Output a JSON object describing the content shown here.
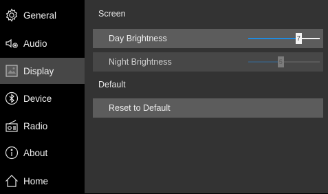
{
  "sidebar": {
    "items": [
      {
        "label": "General",
        "icon": "gear-icon",
        "active": false
      },
      {
        "label": "Audio",
        "icon": "speaker-icon",
        "active": false
      },
      {
        "label": "Display",
        "icon": "display-icon",
        "active": true
      },
      {
        "label": "Device",
        "icon": "bluetooth-icon",
        "active": false
      },
      {
        "label": "Radio",
        "icon": "radio-icon",
        "active": false
      },
      {
        "label": "About",
        "icon": "info-icon",
        "active": false
      },
      {
        "label": "Home",
        "icon": "home-icon",
        "active": false
      }
    ]
  },
  "screen": {
    "title": "Screen",
    "day_brightness": {
      "label": "Day Brightness",
      "value": "7",
      "level": 0.7
    },
    "night_brightness": {
      "label": "Night Brightness",
      "value": "5",
      "level": 0.45,
      "enabled": false
    }
  },
  "default": {
    "title": "Default",
    "reset_label": "Reset to Default"
  },
  "colors": {
    "accent": "#1f8be0",
    "panel": "#333333",
    "row": "#5c5c5c",
    "active_nav": "#474747"
  }
}
